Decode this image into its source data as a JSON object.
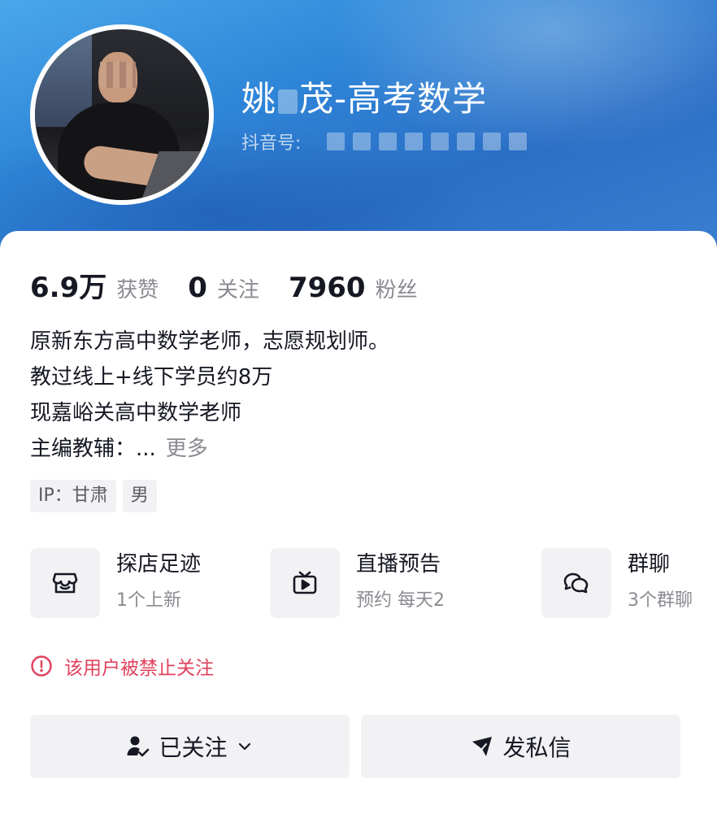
{
  "profile": {
    "name_part1": "姚",
    "name_part2": "茂-高考数学",
    "douyin_id_label": "抖音号: "
  },
  "stats": [
    {
      "value": "6.9万",
      "label": "获赞"
    },
    {
      "value": "0",
      "label": "关注"
    },
    {
      "value": "7960",
      "label": "粉丝"
    }
  ],
  "bio": {
    "lines": [
      "原新东方高中数学老师，志愿规划师。",
      "教过线上+线下学员约8万",
      "现嘉峪关高中数学老师",
      "主编教辅：..."
    ],
    "more_label": "更多"
  },
  "tags": [
    {
      "label": "IP：甘肃"
    },
    {
      "label": "男"
    }
  ],
  "features": [
    {
      "icon": "store-icon",
      "title": "探店足迹",
      "subtitle": "1个上新"
    },
    {
      "icon": "tv-play-icon",
      "title": "直播预告",
      "subtitle": "预约 每天2"
    },
    {
      "icon": "chat-bubbles-icon",
      "title": "群聊",
      "subtitle": "3个群聊"
    }
  ],
  "warning": {
    "icon": "alert-circle-icon",
    "text": "该用户被禁止关注",
    "color": "#e0415d"
  },
  "actions": {
    "follow_label": "已关注",
    "message_label": "发私信"
  },
  "colors": {
    "header_gradient_start": "#4aa7ea",
    "header_gradient_end": "#2a6fc6",
    "text_primary": "#161823",
    "text_secondary": "#8a8b91",
    "button_bg": "#f2f2f4"
  }
}
